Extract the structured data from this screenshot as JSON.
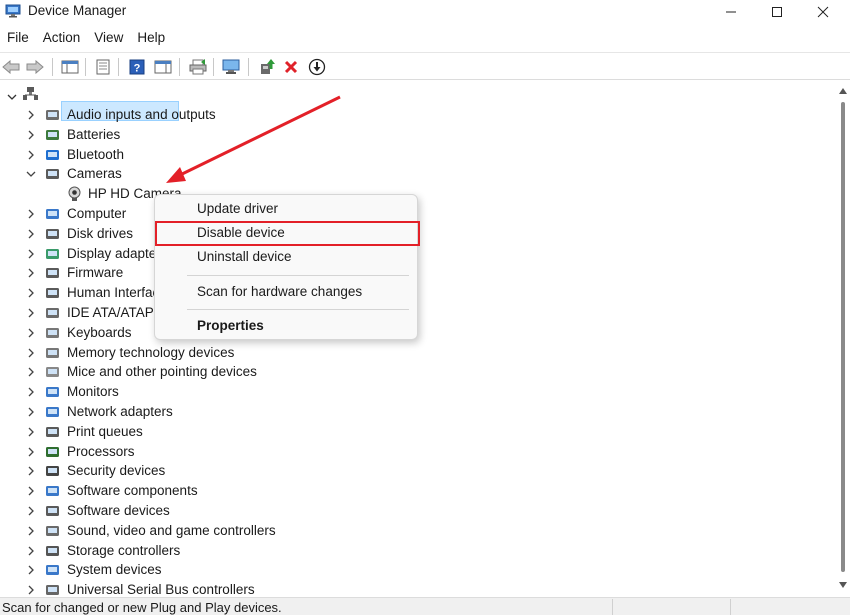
{
  "window": {
    "title": "Device Manager"
  },
  "menu": {
    "items": [
      "File",
      "Action",
      "View",
      "Help"
    ]
  },
  "toolbar": {
    "buttons": [
      "back-icon",
      "forward-icon",
      "show-hide-console-tree-icon",
      "properties-icon",
      "help-icon",
      "action-pane-icon",
      "print-icon",
      "scan-hardware-icon",
      "update-driver-icon",
      "uninstall-icon",
      "disable-device-icon"
    ]
  },
  "tree": {
    "categories": [
      {
        "label": "Audio inputs and outputs",
        "expanded": false
      },
      {
        "label": "Batteries",
        "expanded": false
      },
      {
        "label": "Bluetooth",
        "expanded": false
      },
      {
        "label": "Cameras",
        "expanded": true,
        "children": [
          "HP HD Camera"
        ]
      },
      {
        "label": "Computer",
        "expanded": false
      },
      {
        "label": "Disk drives",
        "expanded": false
      },
      {
        "label": "Display adapters",
        "expanded": false
      },
      {
        "label": "Firmware",
        "expanded": false
      },
      {
        "label": "Human Interface Devices",
        "expanded": false
      },
      {
        "label": "IDE ATA/ATAPI controllers",
        "expanded": false
      },
      {
        "label": "Keyboards",
        "expanded": false
      },
      {
        "label": "Memory technology devices",
        "expanded": false
      },
      {
        "label": "Mice and other pointing devices",
        "expanded": false
      },
      {
        "label": "Monitors",
        "expanded": false
      },
      {
        "label": "Network adapters",
        "expanded": false
      },
      {
        "label": "Print queues",
        "expanded": false
      },
      {
        "label": "Processors",
        "expanded": false
      },
      {
        "label": "Security devices",
        "expanded": false
      },
      {
        "label": "Software components",
        "expanded": false
      },
      {
        "label": "Software devices",
        "expanded": false
      },
      {
        "label": "Sound, video and game controllers",
        "expanded": false
      },
      {
        "label": "Storage controllers",
        "expanded": false
      },
      {
        "label": "System devices",
        "expanded": false
      },
      {
        "label": "Universal Serial Bus controllers",
        "expanded": false
      }
    ],
    "selected": "HP HD Camera"
  },
  "context_menu": {
    "update_driver": "Update driver",
    "disable_device": "Disable device",
    "uninstall_device": "Uninstall device",
    "scan_changes": "Scan for hardware changes",
    "properties": "Properties"
  },
  "status": {
    "text": "Scan for changed or new Plug and Play devices."
  },
  "colors": {
    "highlight_red": "#e32028",
    "selection_bg": "#cce8ff",
    "accent_blue": "#1f6fd0"
  }
}
